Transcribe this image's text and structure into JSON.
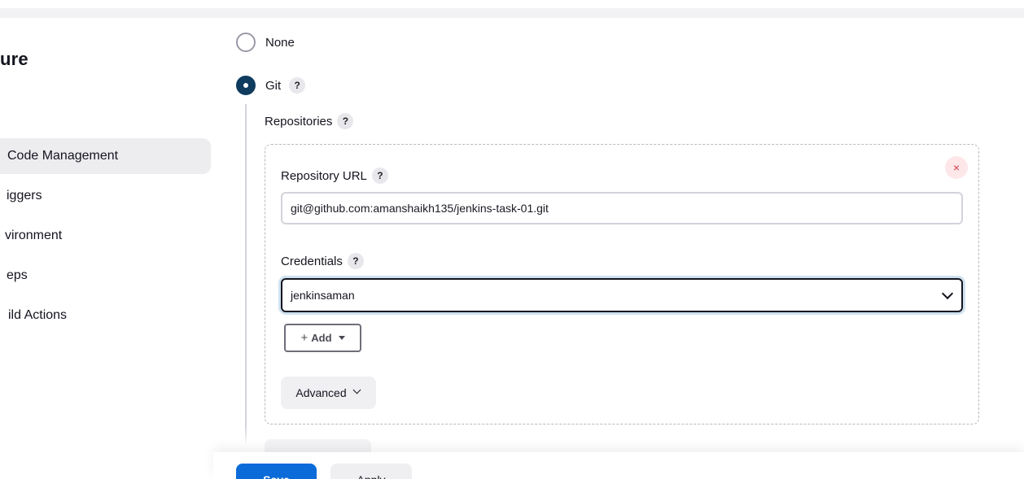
{
  "page": {
    "title": "ure"
  },
  "sidebar": {
    "items": [
      {
        "label": "Code Management",
        "active": true
      },
      {
        "label": "iggers",
        "active": false
      },
      {
        "label": "vironment",
        "active": false
      },
      {
        "label": "eps",
        "active": false
      },
      {
        "label": "ild Actions",
        "active": false
      }
    ]
  },
  "scm": {
    "options": [
      {
        "label": "None",
        "selected": false
      },
      {
        "label": "Git",
        "selected": true
      }
    ],
    "help_glyph": "?",
    "repositories_label": "Repositories",
    "repository_url_label": "Repository URL",
    "repository_url_value": "git@github.com:amanshaikh135/jenkins-task-01.git",
    "credentials_label": "Credentials",
    "credentials_value": "jenkinsaman",
    "add_label": "Add",
    "add_plus": "+",
    "advanced_label": "Advanced",
    "close_glyph": "×"
  },
  "footer": {
    "save_label": "Save",
    "apply_label": "Apply"
  },
  "colors": {
    "primary": "#0b6bd8",
    "radio_checked": "#0f3b5f",
    "close_icon": "#d33a4a"
  },
  "icons": {
    "help": "help-circle-icon",
    "close": "close-icon",
    "chevron": "chevron-down-icon",
    "caret": "caret-down-icon"
  }
}
